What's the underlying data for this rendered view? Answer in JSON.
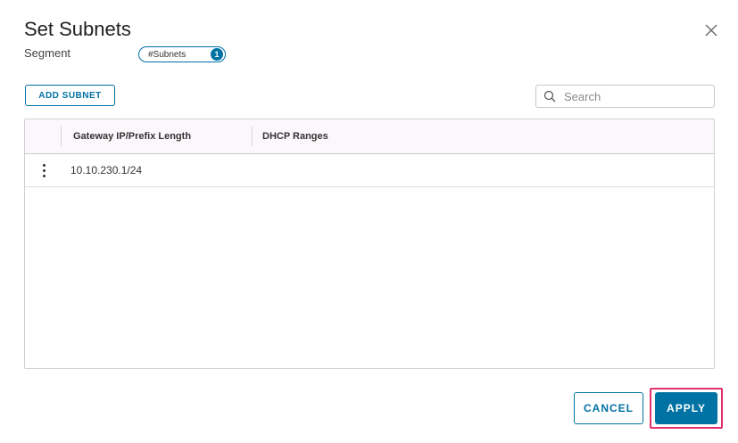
{
  "dialog": {
    "title": "Set Subnets",
    "close_icon": "close-icon"
  },
  "segment": {
    "label": "Segment",
    "pill_label": "#Subnets",
    "count": "1"
  },
  "toolbar": {
    "add_label": "ADD SUBNET",
    "search_placeholder": "Search",
    "search_value": "",
    "search_icon": "search-icon"
  },
  "table": {
    "columns": [
      "Gateway IP/Prefix Length",
      "DHCP Ranges"
    ],
    "rows": [
      {
        "gateway": "10.10.230.1/24",
        "dhcp": "",
        "menu_icon": "more-vertical-icon"
      }
    ]
  },
  "footer": {
    "cancel_label": "CANCEL",
    "apply_label": "APPLY"
  },
  "colors": {
    "primary": "#0072a3",
    "highlight": "#e4306f",
    "header_bg": "#fbf7fb"
  }
}
